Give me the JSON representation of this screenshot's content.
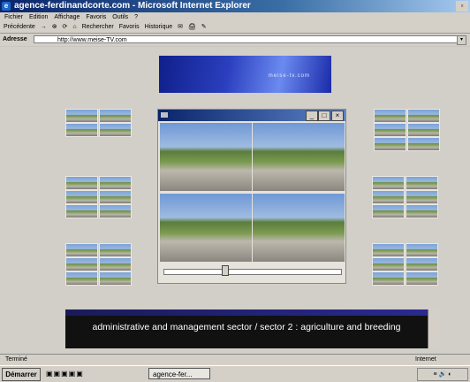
{
  "window": {
    "title": "agence-ferdinandcorte.com - Microsoft Internet Explorer",
    "icon": "ie-icon"
  },
  "menu": {
    "items": [
      "Fichier",
      "Edition",
      "Affichage",
      "Favoris",
      "Outils",
      "?"
    ]
  },
  "toolbar": {
    "items": [
      "Précédente",
      "→",
      "⊗",
      "⟳",
      "⌂",
      "Rechercher",
      "Favoris",
      "Historique",
      "✉",
      "🖨",
      "✎"
    ]
  },
  "address": {
    "label": "Adresse",
    "url": "http://www.meise-TV.com"
  },
  "banner": {
    "brand": "meise-tv.com"
  },
  "caption": {
    "text": "administrative and management sector / sector 2 : agriculture and breeding"
  },
  "player": {
    "progress_fraction": 0.34
  },
  "status": {
    "left": "Terminé",
    "right": "Internet"
  },
  "taskbar": {
    "start": "Démarrer",
    "app": "agence-fer...",
    "tray": "≡ 🔊 ◐"
  }
}
